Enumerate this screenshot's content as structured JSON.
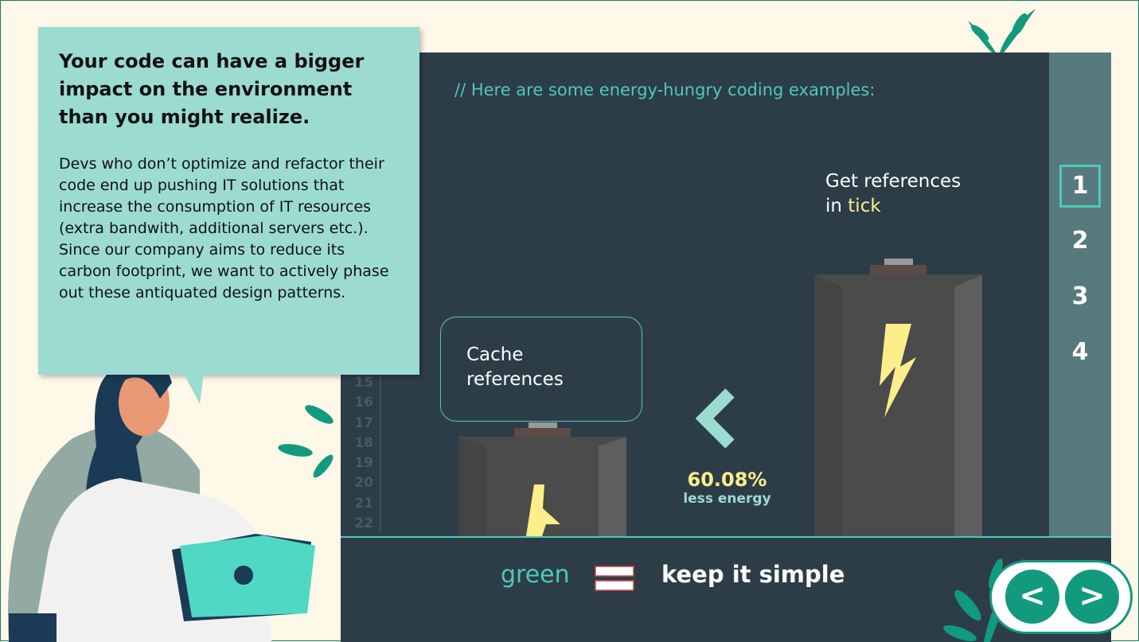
{
  "callout": {
    "title": "Your code can have a bigger impact on the environment than you might realize.",
    "body": "Devs who don’t optimize and refactor their code end up pushing IT solutions that increase the consumption of IT resources (extra bandwith, additional servers etc.). Since our company aims to reduce its carbon footprint, we want to actively phase out these antiquated design patterns."
  },
  "panel": {
    "comment": "// Here are some energy-hungry coding examples:",
    "line_numbers": [
      "15",
      "16",
      "17",
      "18",
      "19",
      "20",
      "21",
      "22"
    ],
    "left_label": "Cache references",
    "right_label_1": "Get references",
    "right_label_2": "in ",
    "right_label_highlight": "tick",
    "percent": "60.08%",
    "percent_label": "less energy"
  },
  "side_nav": {
    "items": [
      "1",
      "2",
      "3",
      "4"
    ],
    "active": "1"
  },
  "footer": {
    "green": "green",
    "kis": "keep it simple"
  },
  "nav": {
    "prev": "<",
    "next": ">"
  },
  "colors": {
    "accent": "#4fc9b4",
    "panel": "#2d3d48",
    "callout": "#9cdbd2",
    "highlight": "#fdee8c",
    "nav": "#129a7e"
  }
}
